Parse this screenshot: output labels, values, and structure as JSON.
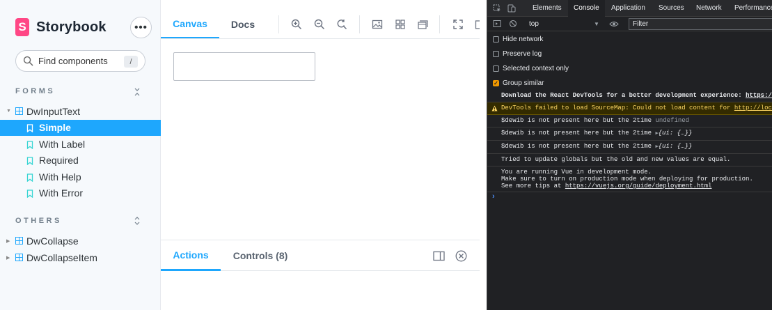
{
  "sidebar": {
    "brand": "Storybook",
    "logo_letter": "S",
    "menu_label": "•••",
    "search": {
      "placeholder": "Find components",
      "shortcut": "/"
    },
    "sections": [
      {
        "title": "FORMS",
        "components": [
          {
            "name": "DwInputText",
            "expanded": true,
            "stories": [
              "Simple",
              "With Label",
              "Required",
              "With Help",
              "With Error"
            ],
            "selected": "Simple"
          }
        ]
      },
      {
        "title": "OTHERS",
        "components": [
          {
            "name": "DwCollapse",
            "expanded": false
          },
          {
            "name": "DwCollapseItem",
            "expanded": false
          }
        ]
      }
    ]
  },
  "toolbar": {
    "tabs": [
      "Canvas",
      "Docs"
    ],
    "active_tab": "Canvas",
    "tools": [
      "zoom-in-icon",
      "zoom-out-icon",
      "zoom-reset-icon",
      "background-icon",
      "grid-icon",
      "measure-icon",
      "fullscreen-icon"
    ]
  },
  "preview": {
    "input_value": ""
  },
  "addons": {
    "tabs": [
      "Actions",
      "Controls (8)"
    ],
    "active_tab": "Actions"
  },
  "devtools": {
    "tabs": [
      "Elements",
      "Console",
      "Application",
      "Sources",
      "Network",
      "Performance"
    ],
    "active_tab": "Console",
    "context": "top",
    "filter_placeholder": "Filter",
    "options": [
      {
        "label": "Hide network",
        "checked": false
      },
      {
        "label": "Preserve log",
        "checked": false
      },
      {
        "label": "Selected context only",
        "checked": false
      },
      {
        "label": "Group similar",
        "checked": true
      }
    ],
    "logs": {
      "devtools_msg": "Download the React DevTools for a better development experience: ",
      "devtools_link": "https://f",
      "warn_msg": "DevTools failed to load SourceMap: Could not load content for ",
      "warn_link": "http://local",
      "dewib1_text": "$dewib is not present here but the 2time ",
      "dewib1_value": "undefined",
      "dewib2_text": "$dewib is not present here but the 2time ",
      "dewib2_obj": "{ui: {…}}",
      "dewib3_text": "$dewib is not present here but the 2time ",
      "dewib3_obj": "{ui: {…}}",
      "globals_msg": "Tried to update globals but the old and new values are equal.",
      "vue_line1": "You are running Vue in development mode.",
      "vue_line2": "Make sure to turn on production mode when deploying for production.",
      "vue_line3": "See more tips at ",
      "vue_link": "https://vuejs.org/guide/deployment.html",
      "prompt": "›"
    }
  }
}
